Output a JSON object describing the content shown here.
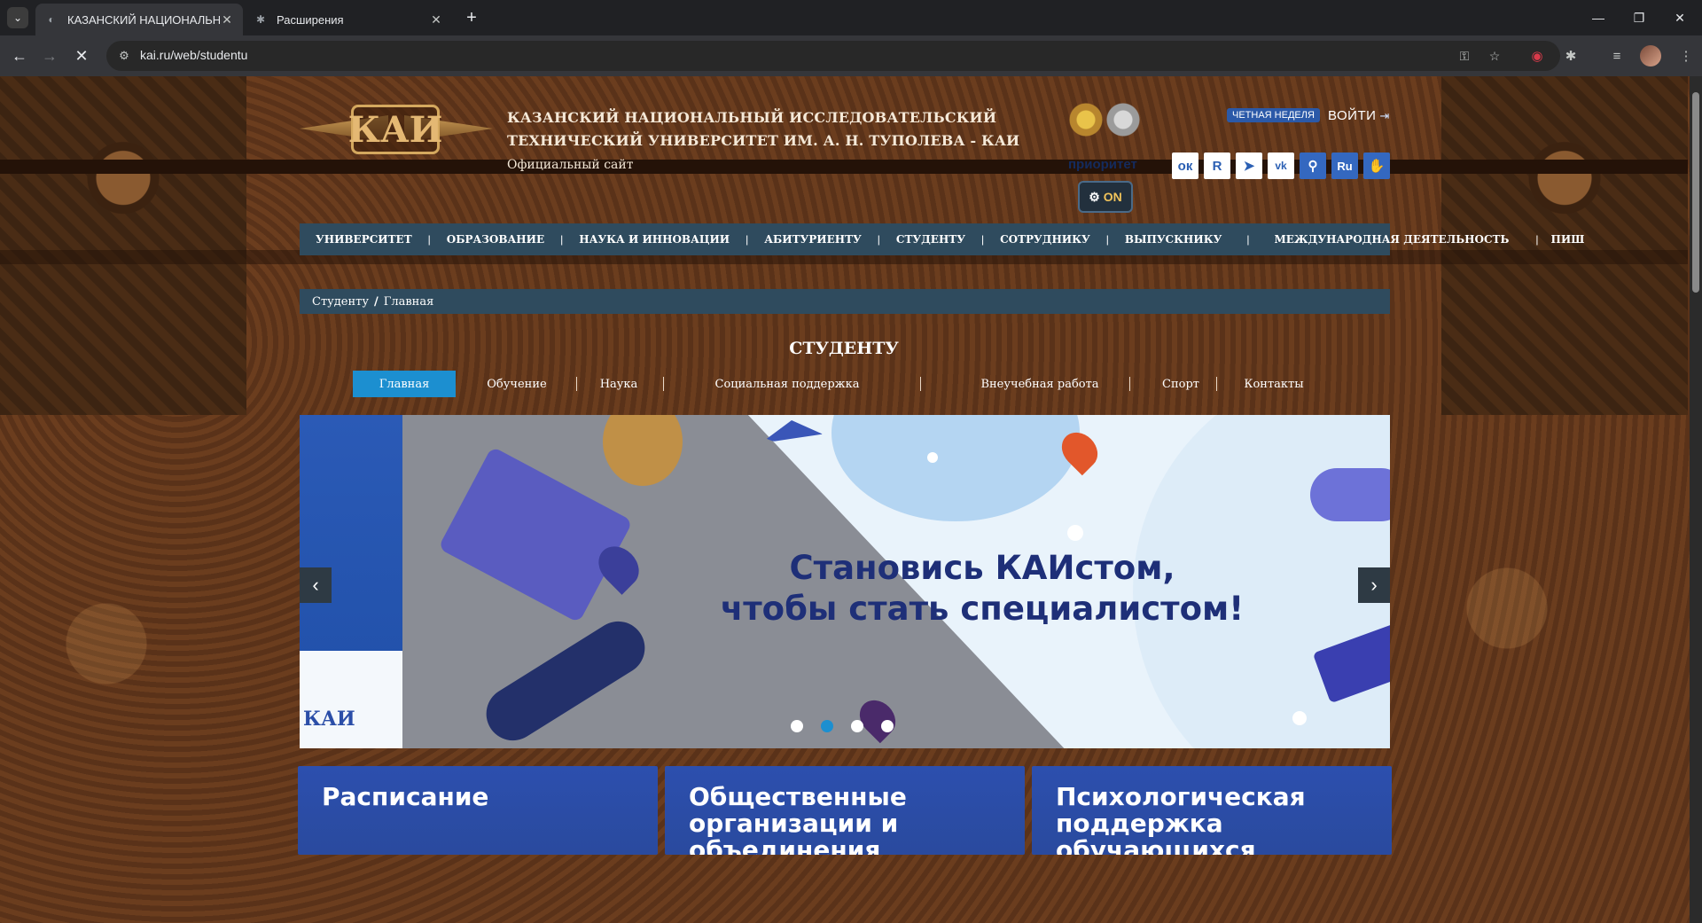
{
  "browser": {
    "tabs": [
      {
        "title": "КАЗАНСКИЙ НАЦИОНАЛЬНЫЙ",
        "active": true
      },
      {
        "title": "Расширения",
        "active": false
      }
    ],
    "new_tab": "+",
    "url": "kai.ru/web/studentu",
    "window_controls": {
      "minimize": "—",
      "restore": "❐",
      "close": "✕"
    }
  },
  "site": {
    "logo_text": "КАИ",
    "name_line1": "КАЗАНСКИЙ НАЦИОНАЛЬНЫЙ ИССЛЕДОВАТЕЛЬСКИЙ",
    "name_line2": "ТЕХНИЧЕСКИЙ УНИВЕРСИТЕТ ИМ. А. Н. ТУПОЛЕВА - КАИ",
    "subtitle": "Официальный сайт",
    "week_badge": "ЧЕТНАЯ НЕДЕЛЯ",
    "login": "ВОЙТИ",
    "priority": "приоритет",
    "social": [
      "ок",
      "R",
      "➤",
      "vk"
    ],
    "lang": "Ru",
    "accessibility_on": "ON"
  },
  "mainnav": [
    "УНИВЕРСИТЕТ",
    "ОБРАЗОВАНИЕ",
    "НАУКА И ИННОВАЦИИ",
    "АБИТУРИЕНТУ",
    "СТУДЕНТУ",
    "СОТРУДНИКУ",
    "ВЫПУСКНИКУ",
    "МЕЖДУНАРОДНАЯ ДЕЯТЕЛЬНОСТЬ",
    "ПИШ"
  ],
  "breadcrumb": {
    "parent": "Студенту",
    "current": "Главная"
  },
  "section": {
    "title": "СТУДЕНТУ",
    "tabs": [
      "Главная",
      "Обучение",
      "Наука",
      "Социальная поддержка",
      "Внеучебная работа",
      "Спорт",
      "Контакты"
    ],
    "active_tab": "Главная"
  },
  "slider": {
    "headline_line1": "Становись КАИстом,",
    "headline_line2": "чтобы стать специалистом!",
    "slides_count": 4,
    "active_slide": 2,
    "prev": "‹",
    "next": "›"
  },
  "cards": [
    {
      "title": "Расписание"
    },
    {
      "title": "Общественные организации и объединения"
    },
    {
      "title": "Психологическая поддержка обучающихся"
    }
  ],
  "colors": {
    "nav_bg": "#2f4b5e",
    "accent": "#1c8fd0",
    "headline": "#1e2f78",
    "card_bg": "#2c4fae"
  }
}
